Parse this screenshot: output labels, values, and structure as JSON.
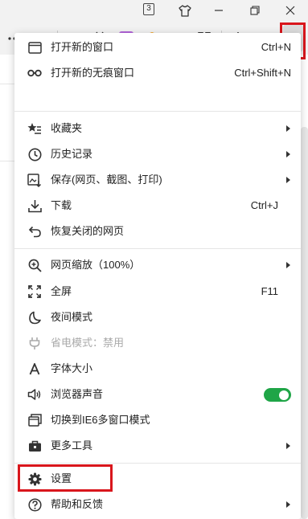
{
  "titlebar": {
    "tab_count": "3"
  },
  "menu": {
    "items": [
      {
        "label": "打开新的窗口",
        "shortcut": "Ctrl+N"
      },
      {
        "label": "打开新的无痕窗口",
        "shortcut": "Ctrl+Shift+N"
      },
      {
        "label": "收藏夹"
      },
      {
        "label": "历史记录"
      },
      {
        "label": "保存(网页、截图、打印)"
      },
      {
        "label": "下载",
        "shortcut": "Ctrl+J"
      },
      {
        "label": "恢复关闭的网页"
      },
      {
        "label": "网页缩放（100%）"
      },
      {
        "label": "全屏",
        "shortcut": "F11"
      },
      {
        "label": "夜间模式"
      },
      {
        "label": "省电模式：禁用"
      },
      {
        "label": "字体大小"
      },
      {
        "label": "浏览器声音",
        "toggle_on": true
      },
      {
        "label": "切换到IE6多窗口模式"
      },
      {
        "label": "更多工具"
      },
      {
        "label": "设置"
      },
      {
        "label": "帮助和反馈"
      }
    ]
  },
  "colors": {
    "highlight": "#d9161c",
    "toggle_on": "#1fa547"
  },
  "icons": [
    "skin-icon",
    "minimize-icon",
    "restore-icon",
    "close-icon",
    "more-icon",
    "chevron-down-icon",
    "reader-icon",
    "scissors-icon",
    "translate-icon",
    "shield-icon",
    "game-icon",
    "apps-icon",
    "download-icon",
    "undo-icon",
    "hamburger-menu-icon"
  ]
}
